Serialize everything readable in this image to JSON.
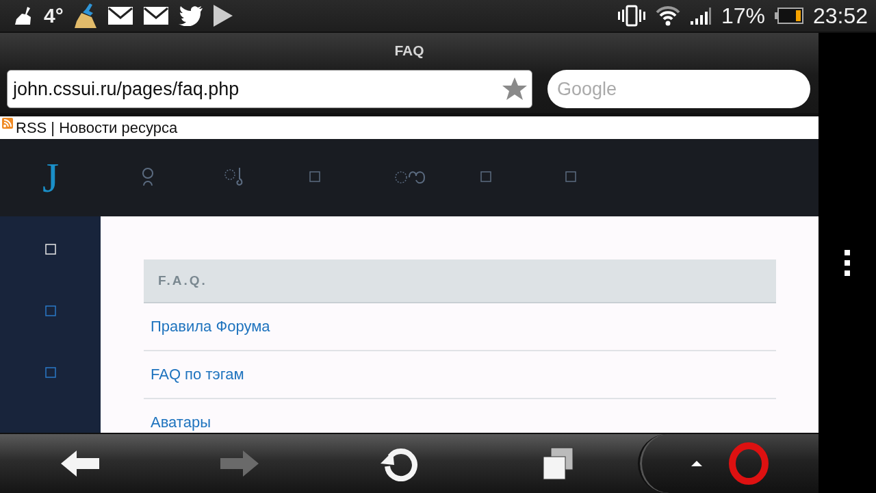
{
  "status_bar": {
    "temperature": "4°",
    "battery_percent": "17%",
    "time": "23:52"
  },
  "browser": {
    "title": "FAQ",
    "address": "john.cssui.ru/pages/faq.php",
    "search": {
      "placeholder": "Google"
    }
  },
  "rss_link": "RSS | Новости ресурса",
  "site": {
    "logo": "J",
    "panel": {
      "heading": "F.A.Q.",
      "links": [
        "Правила Форума",
        "FAQ по тэгам",
        "Аватары"
      ]
    }
  },
  "toolbar": {
    "buttons": [
      {
        "kind": "back",
        "disabled": false
      },
      {
        "kind": "forward",
        "disabled": true
      },
      {
        "kind": "reload",
        "disabled": false
      },
      {
        "kind": "tabs",
        "disabled": false
      }
    ]
  }
}
